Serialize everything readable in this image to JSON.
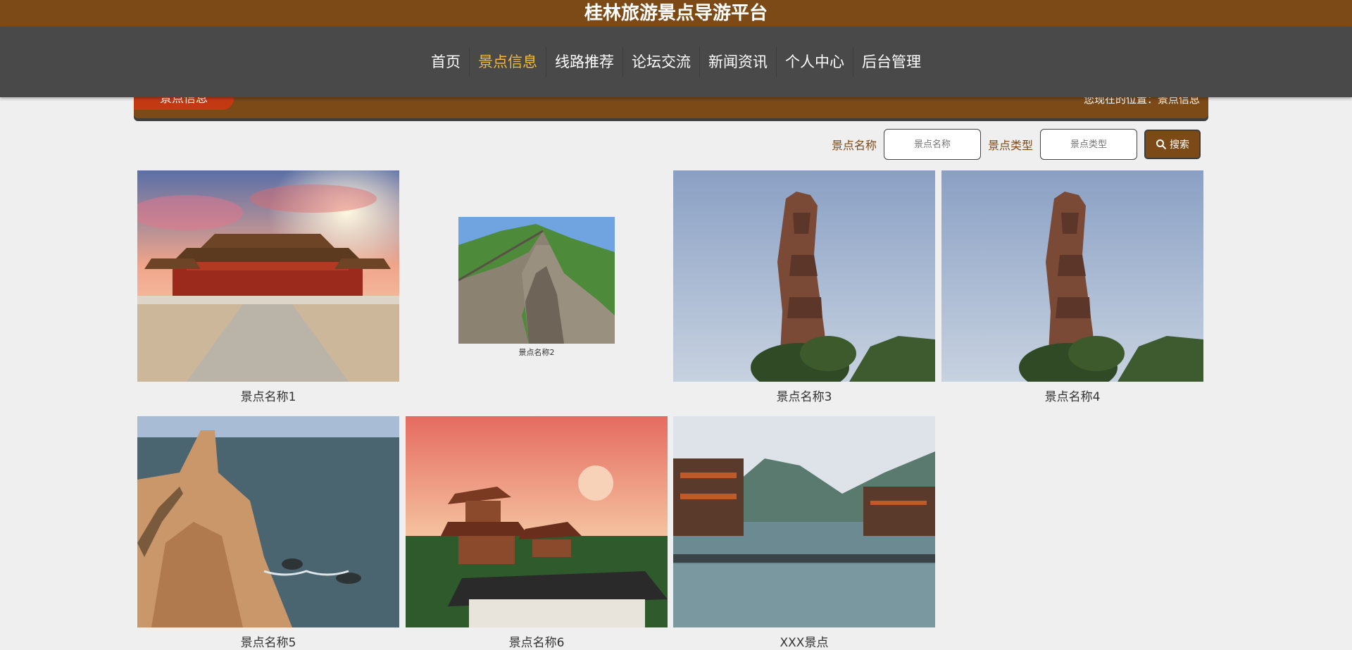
{
  "app": {
    "title": "桂林旅游景点导游平台"
  },
  "nav": {
    "items": [
      {
        "label": "首页"
      },
      {
        "label": "景点信息"
      },
      {
        "label": "线路推荐"
      },
      {
        "label": "论坛交流"
      },
      {
        "label": "新闻资讯"
      },
      {
        "label": "个人中心"
      },
      {
        "label": "后台管理"
      }
    ],
    "active_index": 1
  },
  "breadcrumb": {
    "tab": "景点信息",
    "location": "您现在的位置：景点信息"
  },
  "search": {
    "name_label": "景点名称",
    "name_placeholder": "景点名称",
    "type_label": "景点类型",
    "type_placeholder": "景点类型",
    "button_label": "搜索",
    "button_icon": "search-icon"
  },
  "spots": [
    {
      "name": "景点名称1",
      "image": "palace-photo"
    },
    {
      "name": "景点名称2",
      "image": "great-wall-photo"
    },
    {
      "name": "景点名称3",
      "image": "carved-pillar-photo"
    },
    {
      "name": "景点名称4",
      "image": "carved-pillar-photo"
    },
    {
      "name": "景点名称5",
      "image": "sea-cliff-photo"
    },
    {
      "name": "景点名称6",
      "image": "pavilion-photo"
    },
    {
      "name": "XXX景点",
      "image": "river-town-photo"
    }
  ],
  "colors": {
    "brand_brown": "#7c4a17",
    "nav_bg": "#494949",
    "nav_active": "#f3b936",
    "crumb_tab": "#c33a12"
  }
}
